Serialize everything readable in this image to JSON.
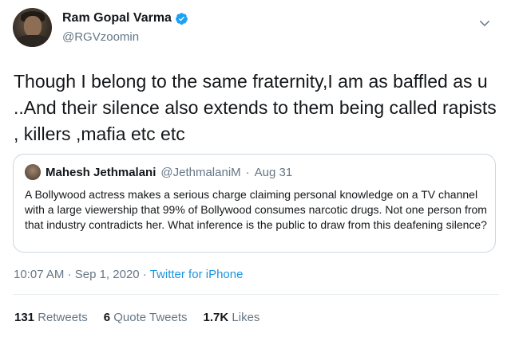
{
  "author": {
    "name": "Ram Gopal Varma",
    "handle": "@RGVzoomin",
    "verified": true
  },
  "tweet_text": "Though I belong to the same fraternity,I am as baffled as u ..And their silence also extends to them being called rapists , killers ,mafia etc etc",
  "quoted_tweet": {
    "name": "Mahesh Jethmalani",
    "handle": "@JethmalaniM",
    "date": "Aug 31",
    "text": "A Bollywood actress makes a serious charge claiming personal knowledge on a TV channel with a large viewership that 99% of Bollywood consumes narcotic drugs. Not one person from that industry contradicts her. What inference is the public to draw from this deafening silence?"
  },
  "timestamp": {
    "time": "10:07 AM",
    "date": "Sep 1, 2020",
    "source": "Twitter for iPhone"
  },
  "stats": {
    "retweets_count": "131",
    "retweets_label": "Retweets",
    "quotes_count": "6",
    "quotes_label": "Quote Tweets",
    "likes_count": "1.7K",
    "likes_label": "Likes"
  },
  "colors": {
    "accent": "#1da1f2",
    "secondary_text": "#657786",
    "border": "#ccd6dd"
  },
  "icons": [
    "verified-badge-icon",
    "chevron-down-icon"
  ]
}
